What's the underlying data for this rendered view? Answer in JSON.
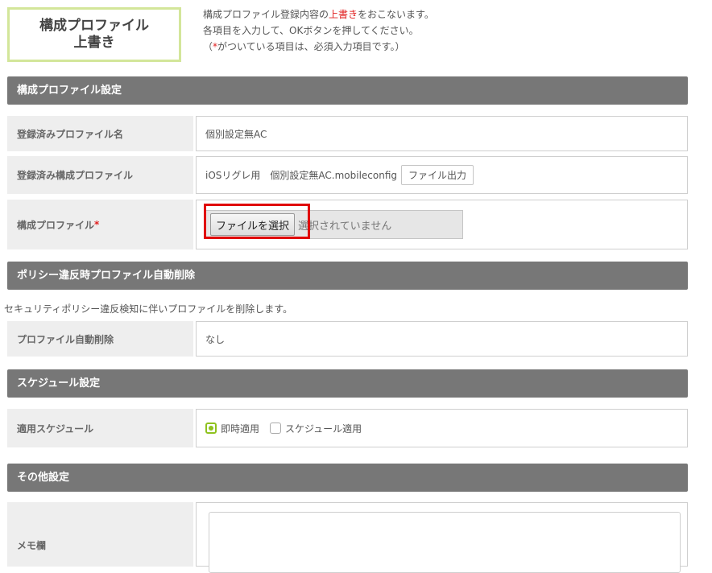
{
  "header": {
    "title_line1": "構成プロファイル",
    "title_line2": "上書き",
    "intro_line1_pre": "構成プロファイル登録内容の",
    "intro_line1_red": "上書き",
    "intro_line1_post": "をおこないます。",
    "intro_line2": "各項目を入力して、OKボタンを押してください。",
    "intro_line3_pre": "（",
    "intro_line3_red": "*",
    "intro_line3_post": "がついている項目は、必須入力項目です。）"
  },
  "sections": {
    "profile_settings": "構成プロファイル設定",
    "policy_delete": "ポリシー違反時プロファイル自動削除",
    "schedule": "スケジュール設定",
    "other": "その他設定"
  },
  "fields": {
    "registered_name_label": "登録済みプロファイル名",
    "registered_name_value": "個別設定無AC",
    "registered_profile_label": "登録済み構成プロファイル",
    "registered_profile_value": "iOSリグレ用　個別設定無AC.mobileconfig",
    "export_button": "ファイル出力",
    "profile_label": "構成プロファイル",
    "required_mark": "*",
    "choose_file_button": "ファイルを選択",
    "no_file_text": "選択されていません",
    "policy_note": "セキュリティポリシー違反検知に伴いプロファイルを削除します。",
    "auto_delete_label": "プロファイル自動削除",
    "auto_delete_value": "なし",
    "schedule_label": "適用スケジュール",
    "schedule_option_immediate": "即時適用",
    "schedule_option_scheduled": "スケジュール適用",
    "memo_label": "メモ欄"
  },
  "colors": {
    "section_bg": "#777777",
    "accent_green": "#8fc21f",
    "title_border": "#d3e69a",
    "highlight": "#e00000"
  }
}
